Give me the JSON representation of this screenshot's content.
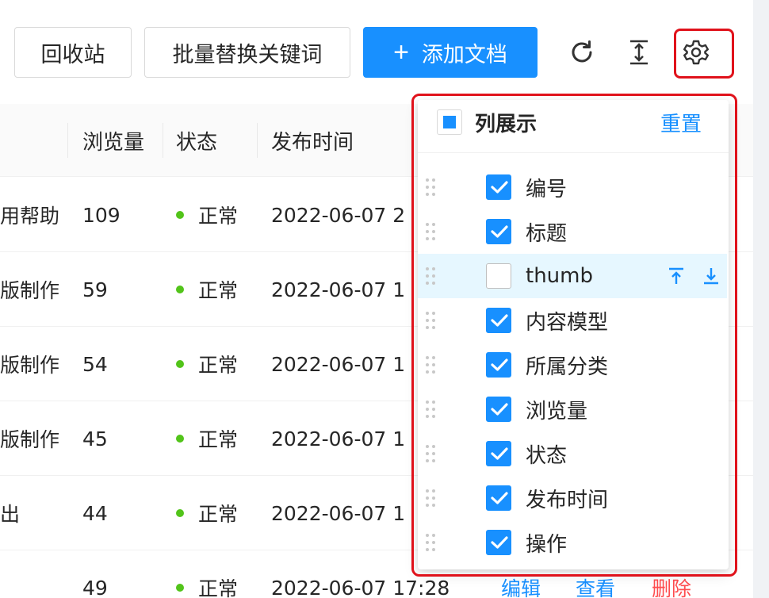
{
  "toolbar": {
    "recycle_label": "回收站",
    "replace_label": "批量替换关键词",
    "add_label": "添加文档",
    "icons": [
      "reload-icon",
      "column-height-icon",
      "setting-icon"
    ]
  },
  "table": {
    "columns": [
      "浏览量",
      "状态",
      "发布时间"
    ],
    "rows": [
      {
        "title": "用帮助",
        "views": "109",
        "status": "正常",
        "time": "2022-06-07 2"
      },
      {
        "title": "版制作",
        "views": "59",
        "status": "正常",
        "time": "2022-06-07 1"
      },
      {
        "title": "版制作",
        "views": "54",
        "status": "正常",
        "time": "2022-06-07 1"
      },
      {
        "title": "版制作",
        "views": "45",
        "status": "正常",
        "time": "2022-06-07 1"
      },
      {
        "title": "出",
        "views": "44",
        "status": "正常",
        "time": "2022-06-07 1"
      },
      {
        "title": "",
        "views": "49",
        "status": "正常",
        "time": "2022-06-07 17:28"
      }
    ],
    "actions": {
      "edit": "编辑",
      "view": "查看",
      "delete": "删除"
    }
  },
  "column_settings": {
    "title": "列展示",
    "reset": "重置",
    "items": [
      {
        "label": "编号",
        "checked": true
      },
      {
        "label": "标题",
        "checked": true
      },
      {
        "label": "thumb",
        "checked": false
      },
      {
        "label": "内容模型",
        "checked": true
      },
      {
        "label": "所属分类",
        "checked": true
      },
      {
        "label": "浏览量",
        "checked": true
      },
      {
        "label": "状态",
        "checked": true
      },
      {
        "label": "发布时间",
        "checked": true
      },
      {
        "label": "操作",
        "checked": true
      }
    ]
  },
  "colors": {
    "primary": "#1890ff",
    "success": "#52c41a",
    "danger": "#ff4d4f",
    "highlight": "#e0121b"
  }
}
